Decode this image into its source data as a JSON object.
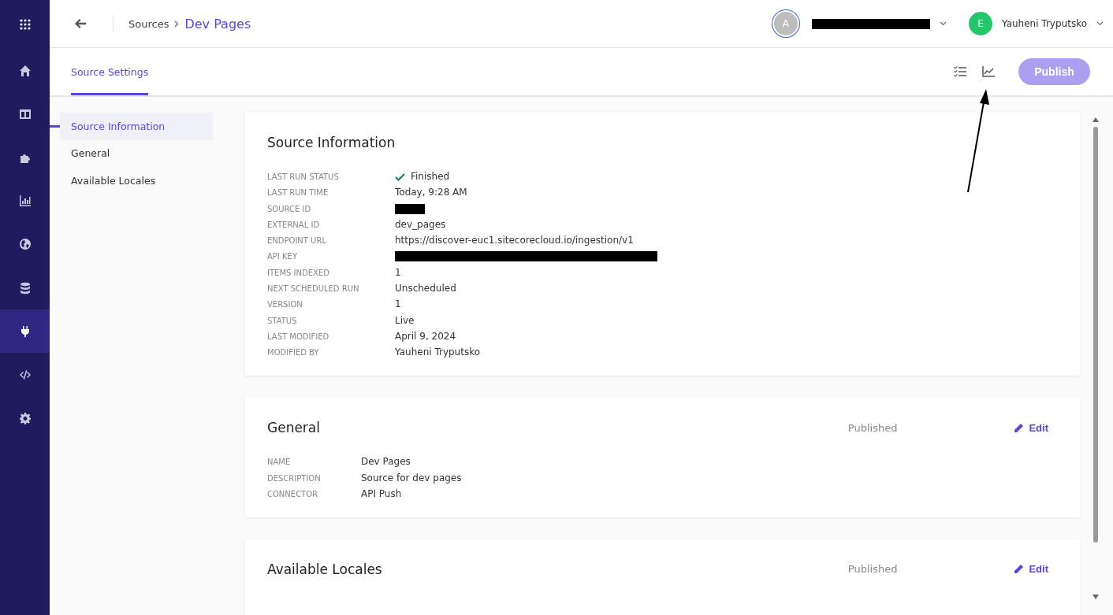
{
  "nav": [
    {
      "kind": "apps",
      "selected": false
    },
    {
      "kind": "home",
      "selected": false
    },
    {
      "kind": "layout",
      "selected": false
    },
    {
      "kind": "puzzle",
      "selected": false
    },
    {
      "kind": "chart",
      "selected": false
    },
    {
      "kind": "globe",
      "selected": false
    },
    {
      "kind": "database",
      "selected": false
    },
    {
      "kind": "plug",
      "selected": true
    },
    {
      "kind": "code",
      "selected": false
    },
    {
      "kind": "gear",
      "selected": false
    }
  ],
  "breadcrumb": {
    "parent": "Sources",
    "current": "Dev Pages"
  },
  "account": {
    "initial": "A"
  },
  "user": {
    "initial": "E",
    "name": "Yauheni Tryputsko"
  },
  "tabs": [
    {
      "label": "Source Settings",
      "selected": true
    }
  ],
  "publish_button": {
    "label": "Publish",
    "disabled": true
  },
  "subnav": [
    {
      "label": "Source Information",
      "selected": true
    },
    {
      "label": "General",
      "selected": false
    },
    {
      "label": "Available Locales",
      "selected": false
    }
  ],
  "cards": [
    {
      "title": "Source Information",
      "fields": [
        {
          "label": "LAST RUN STATUS",
          "kind": "status",
          "value": "Finished"
        },
        {
          "label": "LAST RUN TIME",
          "kind": "text",
          "value": "Today, 9:28 AM"
        },
        {
          "label": "SOURCE ID",
          "kind": "redacted-short"
        },
        {
          "label": "EXTERNAL ID",
          "kind": "text",
          "value": "dev_pages"
        },
        {
          "label": "ENDPOINT URL",
          "kind": "text",
          "value": "https://discover-euc1.sitecorecloud.io/ingestion/v1"
        },
        {
          "label": "API KEY",
          "kind": "redacted-long"
        },
        {
          "label": "ITEMS INDEXED",
          "kind": "text",
          "value": "1"
        },
        {
          "label": "NEXT SCHEDULED RUN",
          "kind": "text",
          "value": "Unscheduled"
        },
        {
          "label": "VERSION",
          "kind": "text",
          "value": "1"
        },
        {
          "label": "STATUS",
          "kind": "text",
          "value": "Live"
        },
        {
          "label": "LAST MODIFIED",
          "kind": "text",
          "value": "April 9, 2024"
        },
        {
          "label": "MODIFIED BY",
          "kind": "text",
          "value": "Yauheni Tryputsko"
        }
      ]
    },
    {
      "title": "General",
      "status": "Published",
      "edit": "Edit",
      "fields": [
        {
          "label": "NAME",
          "kind": "text",
          "value": "Dev Pages"
        },
        {
          "label": "DESCRIPTION",
          "kind": "text",
          "value": "Source for dev pages"
        },
        {
          "label": "CONNECTOR",
          "kind": "text",
          "value": "API Push"
        }
      ]
    },
    {
      "title": "Available Locales",
      "status": "Published",
      "edit": "Edit"
    }
  ]
}
